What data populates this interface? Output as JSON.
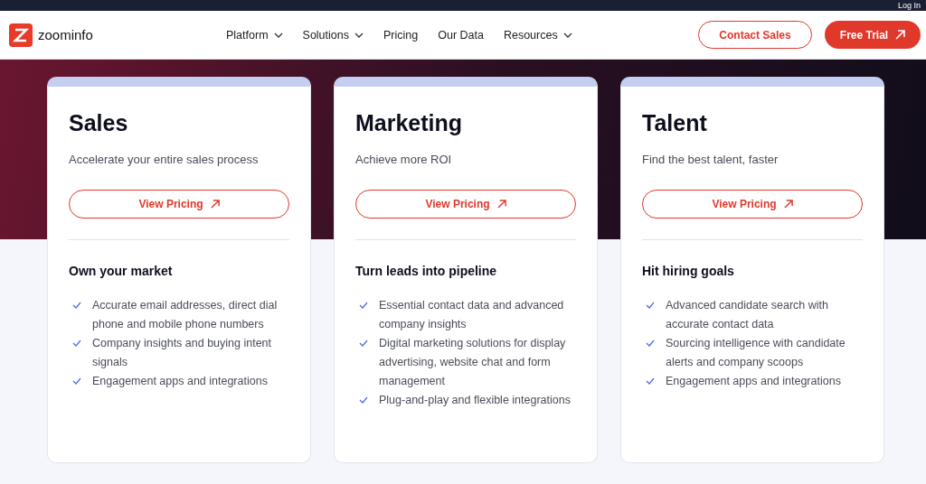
{
  "top_bar": {
    "login": "Log In"
  },
  "header": {
    "logo": "zoominfo",
    "nav": [
      {
        "label": "Platform",
        "dropdown": true
      },
      {
        "label": "Solutions",
        "dropdown": true
      },
      {
        "label": "Pricing",
        "dropdown": false
      },
      {
        "label": "Our Data",
        "dropdown": false
      },
      {
        "label": "Resources",
        "dropdown": true
      }
    ],
    "contact_button": "Contact Sales",
    "trial_button": "Free Trial"
  },
  "cards": [
    {
      "title": "Sales",
      "subtitle": "Accelerate your entire sales process",
      "button": "View Pricing",
      "heading": "Own your market",
      "features": [
        "Accurate email addresses, direct dial phone and mobile phone numbers",
        "Company insights and buying intent signals",
        "Engagement apps and integrations"
      ]
    },
    {
      "title": "Marketing",
      "subtitle": "Achieve more ROI",
      "button": "View Pricing",
      "heading": "Turn leads into pipeline",
      "features": [
        "Essential contact data and advanced company insights",
        "Digital marketing solutions for display advertising, website chat and form management",
        "Plug-and-play and flexible integrations"
      ]
    },
    {
      "title": "Talent",
      "subtitle": "Find the best talent, faster",
      "button": "View Pricing",
      "heading": "Hit hiring goals",
      "features": [
        "Advanced candidate search with accurate contact data",
        "Sourcing intelligence with candidate alerts and company scoops",
        "Engagement apps and integrations"
      ]
    }
  ]
}
